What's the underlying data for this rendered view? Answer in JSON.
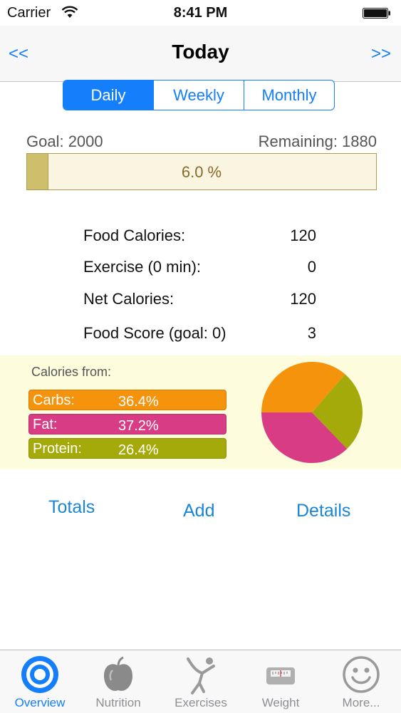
{
  "status_bar": {
    "carrier": "Carrier",
    "time": "8:41 PM"
  },
  "nav": {
    "prev": "<<",
    "title": "Today",
    "next": ">>"
  },
  "segments": [
    "Daily",
    "Weekly",
    "Monthly"
  ],
  "goal": {
    "goal_label": "Goal: 2000",
    "remaining_label": "Remaining: 1880",
    "progress_text": "6.0 %",
    "progress_fraction": 0.06
  },
  "stats": [
    {
      "label": "Food Calories:",
      "value": "120"
    },
    {
      "label": "Exercise (0 min):",
      "value": "0"
    },
    {
      "label": "Net Calories:",
      "value": "120"
    },
    {
      "label": "Food Score (goal: 0)",
      "value": "3"
    }
  ],
  "calories_from": {
    "title": "Calories from:",
    "macros": [
      {
        "name": "Carbs:",
        "percent": "36.4%",
        "value": 36.4,
        "color": "#f5930c"
      },
      {
        "name": "Fat:",
        "percent": "37.2%",
        "value": 37.2,
        "color": "#d83c84"
      },
      {
        "name": "Protein:",
        "percent": "26.4%",
        "value": 26.4,
        "color": "#a4aa0a"
      }
    ]
  },
  "actions": {
    "totals": "Totals",
    "add": "Add",
    "details": "Details"
  },
  "tabs": [
    {
      "label": "Overview",
      "icon": "overview-target-icon",
      "active": true
    },
    {
      "label": "Nutrition",
      "icon": "apple-icon",
      "active": false
    },
    {
      "label": "Exercises",
      "icon": "exercise-figure-icon",
      "active": false
    },
    {
      "label": "Weight",
      "icon": "scale-icon",
      "active": false
    },
    {
      "label": "More...",
      "icon": "smiley-icon",
      "active": false
    }
  ],
  "colors": {
    "accent": "#147efb",
    "link": "#1a86d4",
    "panel_bg": "#fdfcdc",
    "progress_fill": "#cdbf6c"
  }
}
